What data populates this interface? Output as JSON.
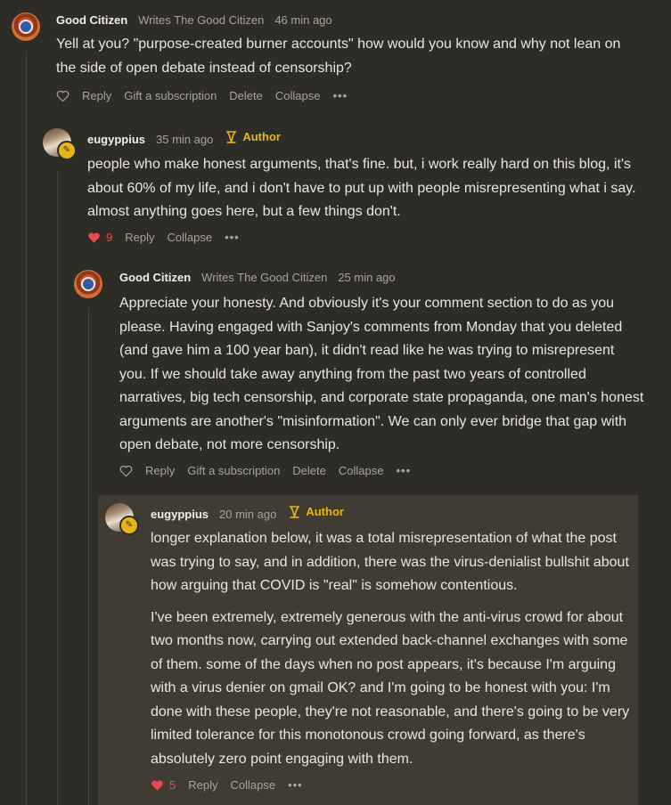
{
  "comments": [
    {
      "name": "Good Citizen",
      "subtitle": "Writes The Good Citizen",
      "time": "46 min ago",
      "body": [
        "Yell at you? \"purpose-created burner accounts\" how would you know and why not lean on the side of open debate instead of censorship?"
      ],
      "actions": {
        "reply": "Reply",
        "gift": "Gift a subscription",
        "delete": "Delete",
        "collapse": "Collapse",
        "more": "•••"
      }
    },
    {
      "name": "eugyppius",
      "time": "35 min ago",
      "author": "Author",
      "body": [
        "people who make honest arguments, that's fine. but, i work really hard on this blog, it's about 60% of my life, and i don't have to put up with people misrepresenting what i say. almost anything goes here, but a few things don't."
      ],
      "likes": "9",
      "actions": {
        "reply": "Reply",
        "collapse": "Collapse",
        "more": "•••"
      }
    },
    {
      "name": "Good Citizen",
      "subtitle": "Writes The Good Citizen",
      "time": "25 min ago",
      "body": [
        "Appreciate your honesty. And obviously it's your comment section to do as you please. Having engaged with Sanjoy's comments from Monday that you deleted (and gave him a 100 year ban), it didn't read like he was trying to misrepresent you. If we should take away anything from the past two years of controlled narratives, big tech censorship, and corporate state propaganda, one man's honest arguments are another's \"misinformation\". We can only ever bridge that gap with open debate, not more censorship."
      ],
      "actions": {
        "reply": "Reply",
        "gift": "Gift a subscription",
        "delete": "Delete",
        "collapse": "Collapse",
        "more": "•••"
      }
    },
    {
      "name": "eugyppius",
      "time": "20 min ago",
      "author": "Author",
      "body": [
        "longer explanation below, it was a total misrepresentation of what the post was trying to say, and in addition, there was the virus-denialist bullshit about how arguing that COVID is \"real\" is somehow contentious.",
        "I've been extremely, extremely generous with the anti-virus crowd for about two months now, carrying out extended back-channel exchanges with some of them. some of the days when no post appears, it's because I'm arguing with a virus denier on gmail OK? and I'm going to be honest with you: I'm done with these people, they're not reasonable, and there's going to be very limited tolerance for this monotonous crowd going forward, as there's absolutely zero point engaging with them."
      ],
      "likes": "5",
      "actions": {
        "reply": "Reply",
        "collapse": "Collapse",
        "more": "•••"
      }
    }
  ],
  "colors": {
    "author": "#e8b518",
    "like": "#e8484f",
    "muted": "#a7a398",
    "background": "#2e2c26"
  }
}
